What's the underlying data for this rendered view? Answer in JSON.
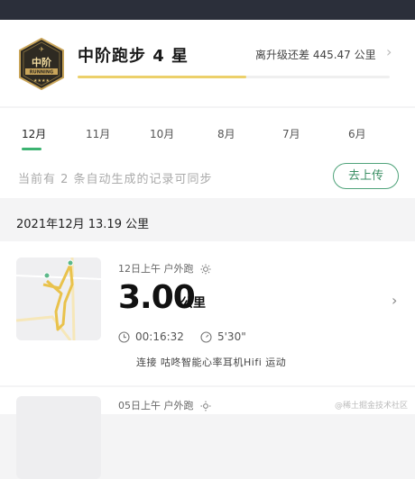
{
  "level": {
    "title": "中阶跑步 4 星",
    "gap_text": "离升级还差 445.47 公里",
    "progress": 0.54,
    "badge_text": "中阶",
    "badge_sub": "RUNNING"
  },
  "months": [
    "12月",
    "11月",
    "10月",
    "8月",
    "7月",
    "6月"
  ],
  "sync": {
    "text": "当前有 2 条自动生成的记录可同步",
    "button": "去上传"
  },
  "month_header": "2021年12月   13.19 公里",
  "runs": [
    {
      "meta": "12日上午  户外跑",
      "distance": "3.00",
      "unit": "公里",
      "duration": "00:16:32",
      "pace": "5'30\"",
      "device": "连接 咕咚智能心率耳机Hifi 运动"
    },
    {
      "meta": "05日上午  户外跑"
    }
  ],
  "watermark": "@稀土掘金技术社区",
  "colors": {
    "accent_green": "#3cb371",
    "progress_yellow": "#ecd06a",
    "statusbar": "#2b2f3a"
  }
}
